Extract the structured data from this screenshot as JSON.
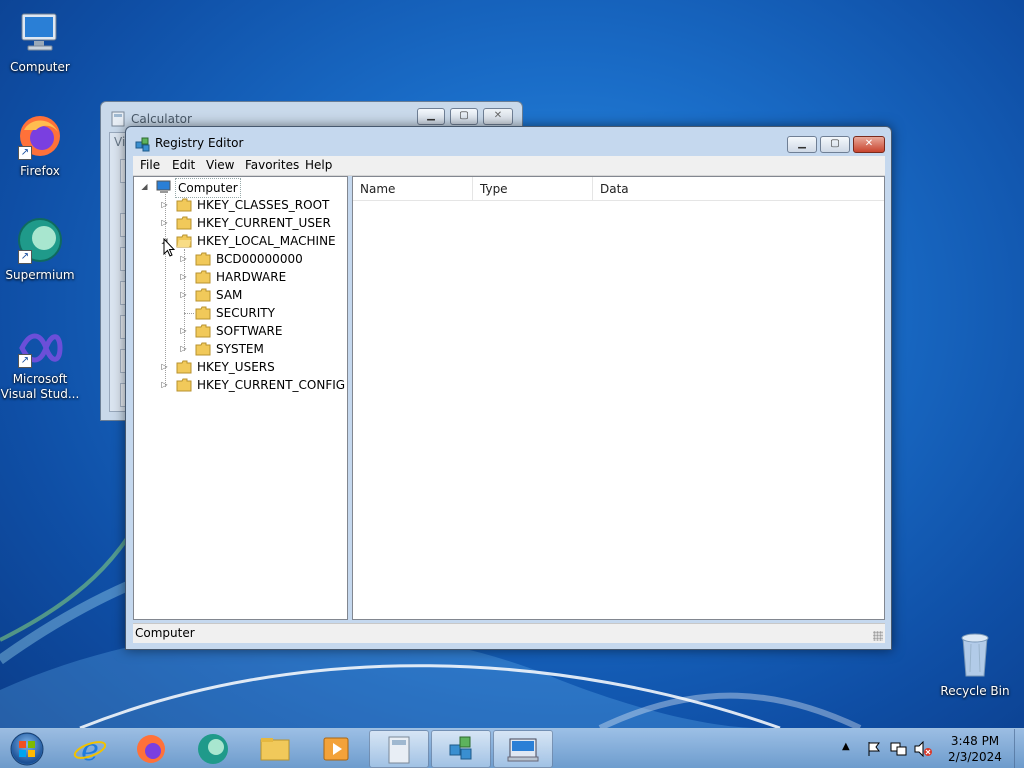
{
  "desktop": {
    "icons": [
      {
        "label": "Computer",
        "icon": "computer-icon"
      },
      {
        "label": "Firefox",
        "icon": "firefox-icon"
      },
      {
        "label": "Supermium",
        "icon": "supermium-icon"
      },
      {
        "label": "Microsoft Visual Stud...",
        "icon": "visual-studio-icon"
      },
      {
        "label": "Recycle Bin",
        "icon": "recycle-bin-icon"
      }
    ]
  },
  "calculator": {
    "title": "Calculator",
    "menu_fragment": "Vi"
  },
  "regedit": {
    "title": "Registry Editor",
    "menu": [
      "File",
      "Edit",
      "View",
      "Favorites",
      "Help"
    ],
    "tree": {
      "root": "Computer",
      "hives": [
        "HKEY_CLASSES_ROOT",
        "HKEY_CURRENT_USER",
        "HKEY_LOCAL_MACHINE"
      ],
      "hklm_children": [
        "BCD00000000",
        "HARDWARE",
        "SAM",
        "SECURITY",
        "SOFTWARE",
        "SYSTEM"
      ],
      "more_hives": [
        "HKEY_USERS",
        "HKEY_CURRENT_CONFIG"
      ]
    },
    "columns": [
      "Name",
      "Type",
      "Data"
    ],
    "status": "Computer"
  },
  "taskbar": {
    "pinned": [
      "internet-explorer-icon",
      "firefox-icon",
      "supermium-icon",
      "file-explorer-icon",
      "media-player-icon",
      "calculator-icon",
      "regedit-icon",
      "keyboard-icon"
    ],
    "clock_time": "3:48 PM",
    "clock_date": "2/3/2024"
  },
  "colors": {
    "desktop_blue": "#1a6dc8",
    "caption_close": "#c8442e",
    "taskbar": "#9fc0e0"
  }
}
